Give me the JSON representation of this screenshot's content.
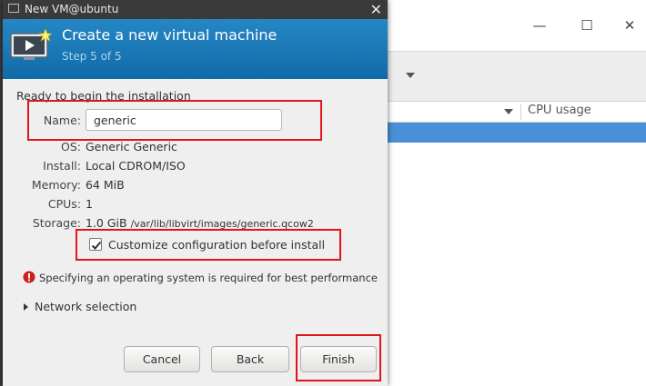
{
  "main_window": {
    "minimize_symbol": "—",
    "maximize_symbol": "☐",
    "close_symbol": "✕",
    "column_cpu_usage": "CPU usage",
    "selection_color": "#4a90d9"
  },
  "dialog": {
    "title": "New VM@ubuntu",
    "close_symbol": "✕",
    "header": {
      "title": "Create a new virtual machine",
      "step": "Step 5 of 5",
      "background": "#1c75b2",
      "icon": "vm-monitor-icon"
    },
    "ready_text": "Ready to begin the installation",
    "fields": {
      "name_label": "Name:",
      "name_value": "generic",
      "os_label": "OS:",
      "os_value": "Generic Generic",
      "install_label": "Install:",
      "install_value": "Local CDROM/ISO",
      "memory_label": "Memory:",
      "memory_value": "64 MiB",
      "cpus_label": "CPUs:",
      "cpus_value": "1",
      "storage_label": "Storage:",
      "storage_size": "1.0 GiB",
      "storage_path": "/var/lib/libvirt/images/generic.qcow2"
    },
    "customize": {
      "label": "Customize configuration before install",
      "checked": true
    },
    "warning": {
      "icon": "error-icon",
      "text": "Specifying an operating system is required for best performance",
      "color": "#cc2020"
    },
    "network": {
      "label": "Network selection",
      "expanded": false
    },
    "buttons": {
      "cancel": "Cancel",
      "back": "Back",
      "finish": "Finish"
    }
  },
  "annotations": {
    "color": "#e0141b"
  }
}
